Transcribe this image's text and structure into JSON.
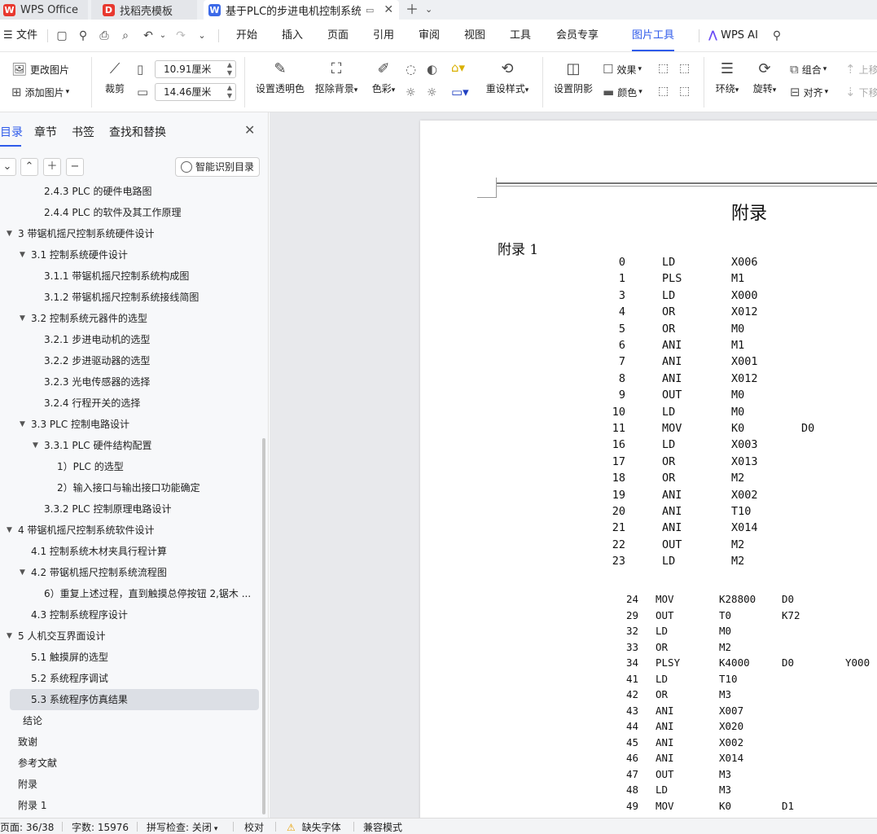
{
  "tabs": {
    "wps": "WPS Office",
    "template": "找稻壳模板",
    "document": "基于PLC的步进电机控制系统设计"
  },
  "menu": {
    "file": "文件",
    "items": [
      "开始",
      "插入",
      "页面",
      "引用",
      "审阅",
      "视图",
      "工具",
      "会员专享",
      "图片工具"
    ],
    "active": "图片工具",
    "wps_ai": "WPS AI"
  },
  "ribbon": {
    "change_picture": "更改图片",
    "add_picture": "添加图片",
    "crop": "裁剪",
    "width": "10.91厘米",
    "height": "14.46厘米",
    "set_transparent": "设置透明色",
    "remove_bg": "抠除背景",
    "color": "色彩",
    "reset_style": "重设样式",
    "set_shadow": "设置阴影",
    "effect": "效果",
    "fill_color": "颜色",
    "wrap": "环绕",
    "rotate": "旋转",
    "group": "组合",
    "align": "对齐",
    "bring_forward": "上移",
    "send_backward": "下移"
  },
  "panel": {
    "tabs": [
      "目录",
      "章节",
      "书签",
      "查找和替换"
    ],
    "ai_toc": "智能识别目录",
    "toc": [
      {
        "text": "2.4.3 PLC 的硬件电路图",
        "level": 3
      },
      {
        "text": "2.4.4 PLC 的软件及其工作原理",
        "level": 3
      },
      {
        "text": "3 带锯机摇尺控制系统硬件设计",
        "level": 1,
        "expanded": true
      },
      {
        "text": "3.1 控制系统硬件设计",
        "level": 2,
        "expanded": true
      },
      {
        "text": "3.1.1 带锯机摇尺控制系统构成图",
        "level": 3
      },
      {
        "text": "3.1.2 带锯机摇尺控制系统接线简图",
        "level": 3
      },
      {
        "text": "3.2 控制系统元器件的选型",
        "level": 2,
        "expanded": true
      },
      {
        "text": "3.2.1 步进电动机的选型",
        "level": 3
      },
      {
        "text": "3.2.2 步进驱动器的选型",
        "level": 3
      },
      {
        "text": "3.2.3 光电传感器的选择",
        "level": 3
      },
      {
        "text": "3.2.4 行程开关的选择",
        "level": 3
      },
      {
        "text": "3.3 PLC 控制电路设计",
        "level": 2,
        "expanded": true
      },
      {
        "text": "3.3.1 PLC 硬件结构配置",
        "level": 3,
        "expanded": true
      },
      {
        "text": "1）PLC 的选型",
        "level": 4
      },
      {
        "text": "2）输入接口与输出接口功能确定",
        "level": 4
      },
      {
        "text": "3.3.2 PLC 控制原理电路设计",
        "level": 3
      },
      {
        "text": "4 带锯机摇尺控制系统软件设计",
        "level": 1,
        "expanded": true
      },
      {
        "text": "4.1 控制系统木材夹具行程计算",
        "level": 2
      },
      {
        "text": "4.2 带锯机摇尺控制系统流程图",
        "level": 2,
        "expanded": true
      },
      {
        "text": "6）重复上述过程，直到触摸总停按钮 2,锯木 ...",
        "level": 3
      },
      {
        "text": "4.3 控制系统程序设计",
        "level": 2
      },
      {
        "text": "5 人机交互界面设计",
        "level": 1,
        "expanded": true
      },
      {
        "text": "5.1 触摸屏的选型",
        "level": 2
      },
      {
        "text": "5.2 系统程序调试",
        "level": 2
      },
      {
        "text": "5.3 系统程序仿真结果",
        "level": 2,
        "selected": true
      },
      {
        "text": "结论",
        "level": "c"
      },
      {
        "text": "致谢",
        "level": 0
      },
      {
        "text": "参考文献",
        "level": 0
      },
      {
        "text": "附录",
        "level": 0
      },
      {
        "text": "附录 1",
        "level": 0
      }
    ]
  },
  "document": {
    "title": "附录",
    "subtitle": "附录 1",
    "block1": [
      [
        "0",
        "LD",
        "X006",
        ""
      ],
      [
        "1",
        "PLS",
        "M1",
        ""
      ],
      [
        "3",
        "LD",
        "X000",
        ""
      ],
      [
        "4",
        "OR",
        "X012",
        ""
      ],
      [
        "5",
        "OR",
        "M0",
        ""
      ],
      [
        "6",
        "ANI",
        "M1",
        ""
      ],
      [
        "7",
        "ANI",
        "X001",
        ""
      ],
      [
        "8",
        "ANI",
        "X012",
        ""
      ],
      [
        "9",
        "OUT",
        "M0",
        ""
      ],
      [
        "10",
        "LD",
        "M0",
        ""
      ],
      [
        "11",
        "MOV",
        "K0",
        "D0"
      ],
      [
        "16",
        "LD",
        "X003",
        ""
      ],
      [
        "17",
        "OR",
        "X013",
        ""
      ],
      [
        "18",
        "OR",
        "M2",
        ""
      ],
      [
        "19",
        "ANI",
        "X002",
        ""
      ],
      [
        "20",
        "ANI",
        "T10",
        ""
      ],
      [
        "21",
        "ANI",
        "X014",
        ""
      ],
      [
        "22",
        "OUT",
        "M2",
        ""
      ],
      [
        "23",
        "LD",
        "M2",
        ""
      ]
    ],
    "block2": [
      [
        "24",
        "MOV",
        "K28800",
        "D0",
        ""
      ],
      [
        "29",
        "OUT",
        "T0",
        "K72",
        ""
      ],
      [
        "32",
        "LD",
        "M0",
        "",
        ""
      ],
      [
        "33",
        "OR",
        "M2",
        "",
        ""
      ],
      [
        "34",
        "PLSY",
        "K4000",
        "D0",
        "Y000"
      ],
      [
        "41",
        "LD",
        "T10",
        "",
        ""
      ],
      [
        "42",
        "OR",
        "M3",
        "",
        ""
      ],
      [
        "43",
        "ANI",
        "X007",
        "",
        ""
      ],
      [
        "44",
        "ANI",
        "X020",
        "",
        ""
      ],
      [
        "45",
        "ANI",
        "X002",
        "",
        ""
      ],
      [
        "46",
        "ANI",
        "X014",
        "",
        ""
      ],
      [
        "47",
        "OUT",
        "M3",
        "",
        ""
      ],
      [
        "48",
        "LD",
        "M3",
        "",
        ""
      ],
      [
        "49",
        "MOV",
        "K0",
        "D1",
        ""
      ]
    ]
  },
  "status": {
    "page": "页面: 36/38",
    "words": "字数: 15976",
    "spell": "拼写检查: 关闭",
    "proofread": "校对",
    "missing_font": "缺失字体",
    "compat": "兼容模式"
  },
  "colors": {
    "accent": "#2f5bea",
    "wps_red": "#e8382f",
    "doc_blue": "#3d6ae8"
  }
}
